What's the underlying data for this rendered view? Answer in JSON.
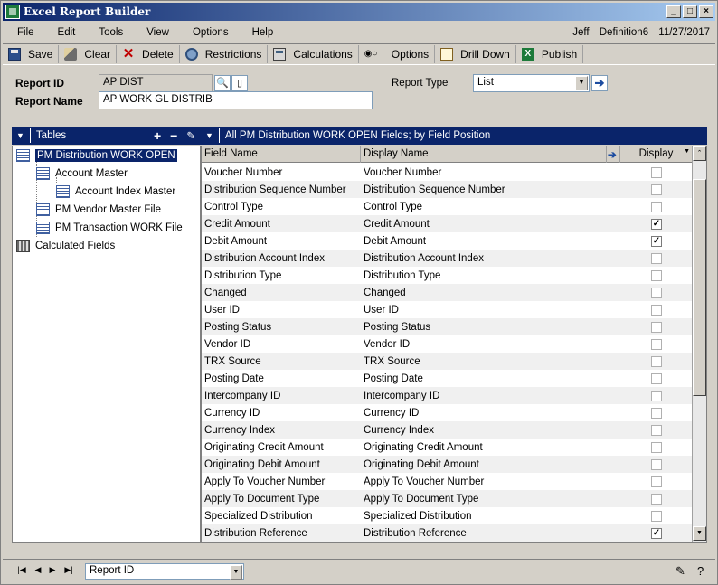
{
  "window": {
    "title": "Excel Report Builder"
  },
  "menu": {
    "items": [
      "File",
      "Edit",
      "Tools",
      "View",
      "Options",
      "Help"
    ],
    "user": "Jeff",
    "company": "Definition6",
    "date": "11/27/2017"
  },
  "toolbar": {
    "save": "Save",
    "clear": "Clear",
    "delete": "Delete",
    "restrictions": "Restrictions",
    "calculations": "Calculations",
    "options": "Options",
    "drill_down": "Drill Down",
    "publish": "Publish"
  },
  "report": {
    "id_label": "Report ID",
    "id_value": "AP DIST",
    "name_label": "Report Name",
    "name_value": "AP WORK GL DISTRIB",
    "type_label": "Report Type",
    "type_value": "List"
  },
  "tables_panel": {
    "title": "Tables",
    "add": "+",
    "remove": "−",
    "items": [
      {
        "label": "PM Distribution WORK OPEN"
      },
      {
        "label": "Account Master"
      },
      {
        "label": "Account Index Master"
      },
      {
        "label": "PM Vendor Master File"
      },
      {
        "label": "PM Transaction WORK File"
      },
      {
        "label": "Calculated Fields"
      }
    ]
  },
  "fields_panel": {
    "title": "All PM Distribution WORK OPEN Fields; by Field Position",
    "columns": [
      "Field Name",
      "Display Name",
      "Display"
    ],
    "rows": [
      {
        "field": "Voucher Number",
        "display": "Voucher Number",
        "checked": false
      },
      {
        "field": "Distribution Sequence Number",
        "display": "Distribution Sequence Number",
        "checked": false
      },
      {
        "field": "Control Type",
        "display": "Control Type",
        "checked": false
      },
      {
        "field": "Credit Amount",
        "display": "Credit Amount",
        "checked": true
      },
      {
        "field": "Debit Amount",
        "display": "Debit Amount",
        "checked": true
      },
      {
        "field": "Distribution Account Index",
        "display": "Distribution Account Index",
        "checked": false
      },
      {
        "field": "Distribution Type",
        "display": "Distribution Type",
        "checked": false
      },
      {
        "field": "Changed",
        "display": "Changed",
        "checked": false
      },
      {
        "field": "User ID",
        "display": "User ID",
        "checked": false
      },
      {
        "field": "Posting Status",
        "display": "Posting Status",
        "checked": false
      },
      {
        "field": "Vendor ID",
        "display": "Vendor ID",
        "checked": false
      },
      {
        "field": "TRX Source",
        "display": "TRX Source",
        "checked": false
      },
      {
        "field": "Posting Date",
        "display": "Posting Date",
        "checked": false
      },
      {
        "field": "Intercompany ID",
        "display": "Intercompany ID",
        "checked": false
      },
      {
        "field": "Currency ID",
        "display": "Currency ID",
        "checked": false
      },
      {
        "field": "Currency Index",
        "display": "Currency Index",
        "checked": false
      },
      {
        "field": "Originating Credit Amount",
        "display": "Originating Credit Amount",
        "checked": false
      },
      {
        "field": "Originating Debit Amount",
        "display": "Originating Debit Amount",
        "checked": false
      },
      {
        "field": "Apply To Voucher Number",
        "display": "Apply To Voucher Number",
        "checked": false
      },
      {
        "field": "Apply To Document Type",
        "display": "Apply To Document Type",
        "checked": false
      },
      {
        "field": "Specialized Distribution",
        "display": "Specialized Distribution",
        "checked": false
      },
      {
        "field": "Distribution Reference",
        "display": "Distribution Reference",
        "checked": true
      }
    ]
  },
  "bottom": {
    "sort_value": "Report ID"
  }
}
